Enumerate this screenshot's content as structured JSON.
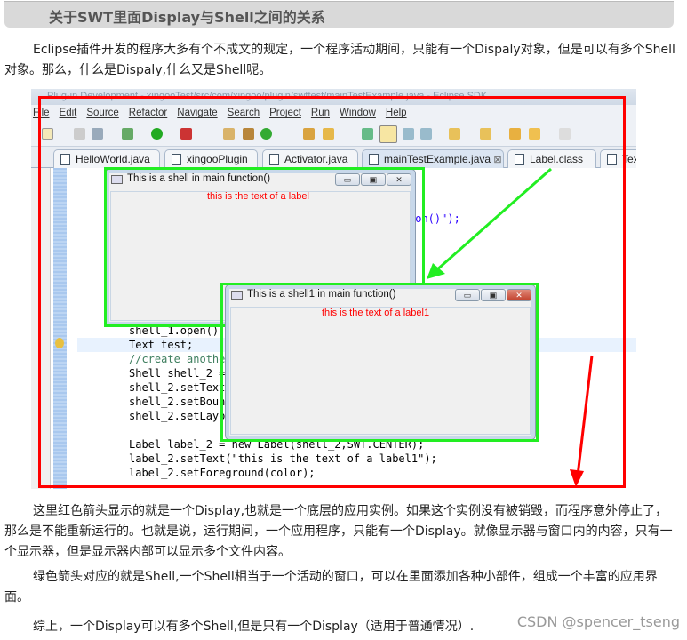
{
  "article": {
    "title": "关于SWT里面Display与Shell之间的关系",
    "p1": "Eclipse插件开发的程序大多有个不成文的规定，一个程序活动期间，只能有一个Dispaly对象，但是可以有多个Shell对象。那么，什么是Dispaly,什么又是Shell呢。",
    "p2": "这里红色箭头显示的就是一个Display,也就是一个底层的应用实例。如果这个实例没有被销毁，而程序意外停止了，那么是不能重新运行的。也就是说，运行期间，一个应用程序，只能有一个Display。就像显示器与窗口内的内容，只有一个显示器，但是显示器内部可以显示多个文件内容。",
    "p3": "绿色箭头对应的就是Shell,一个Shell相当于一个活动的窗口，可以在里面添加各种小部件，组成一个丰富的应用界面。",
    "p4": "综上，一个Display可以有多个Shell,但是只有一个Display（适用于普通情况）.",
    "watermark": "CSDN @spencer_tseng"
  },
  "screenshot": {
    "window_title": "Plug-in Development - xingooTest/src/com/xingoo/plugin/swttest/mainTestExample.java - Eclipse SDK",
    "menu": [
      "File",
      "Edit",
      "Source",
      "Refactor",
      "Navigate",
      "Search",
      "Project",
      "Run",
      "Window",
      "Help"
    ],
    "tabs": [
      {
        "label": "HelloWorld.java"
      },
      {
        "label": "xingooPlugin"
      },
      {
        "label": "Activator.java"
      },
      {
        "label": "mainTestExample.java",
        "active": true,
        "close": "⊠"
      },
      {
        "label": "Label.class"
      },
      {
        "label": "Text.c"
      }
    ],
    "code_fragment": "ion()\");",
    "code": [
      "shell_1.open();",
      "Text test;",
      "//create anothe",
      "Shell shell_2 =",
      "shell_2.setText",
      "shell_2.setBoun",
      "shell_2.setLayo",
      "",
      "Label label_2 = new Label(shell_2,SWT.CENTER);",
      "label_2.setText(\"this is the text of a label1\");",
      "label_2.setForeground(color);"
    ],
    "shell1": {
      "title": "This is a shell in main function()",
      "label": "this is the text of a label"
    },
    "shell2": {
      "title": "This is a shell1 in main function()",
      "label": "this is the text of a label1"
    },
    "colors": {
      "display_arrow": "#ff0000",
      "shell_arrow": "#22ee22"
    }
  }
}
